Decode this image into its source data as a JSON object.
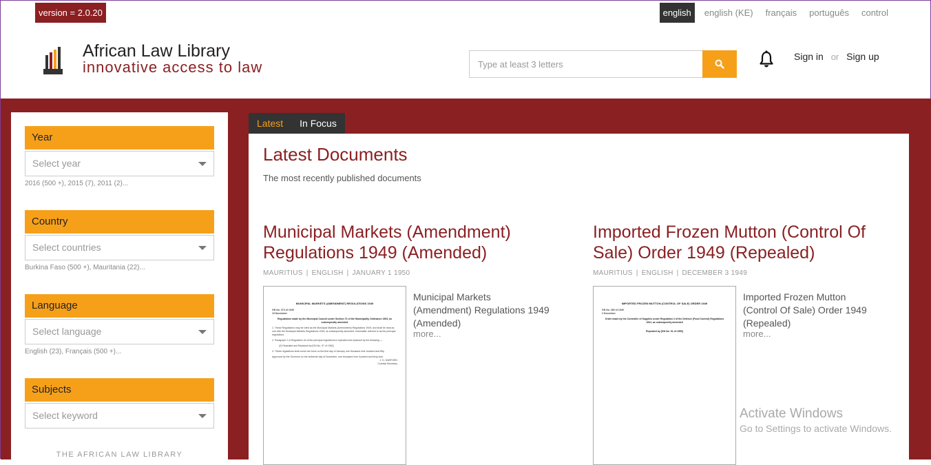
{
  "header": {
    "version": "version = 2.0.20",
    "languages": [
      "english",
      "english (KE)",
      "français",
      "português",
      "control"
    ],
    "brand_title": "African Law Library",
    "brand_tagline": "innovative access to law",
    "search_placeholder": "Type at least 3 letters",
    "sign_in": "Sign in",
    "or": "or",
    "sign_up": "Sign up"
  },
  "sidebar": {
    "filters": [
      {
        "label": "Year",
        "placeholder": "Select year",
        "hint": "2016 (500 +), 2015 (7), 2011 (2)..."
      },
      {
        "label": "Country",
        "placeholder": "Select countries",
        "hint": "Burkina Faso (500 +), Mauritania (22)..."
      },
      {
        "label": "Language",
        "placeholder": "Select language",
        "hint": "English (23), Français (500 +)..."
      },
      {
        "label": "Subjects",
        "placeholder": "Select keyword",
        "hint": ""
      }
    ],
    "footer": "THE AFRICAN LAW LIBRARY"
  },
  "tabs": [
    "Latest",
    "In Focus"
  ],
  "main": {
    "title": "Latest Documents",
    "subtitle": "The most recently published documents",
    "documents": [
      {
        "title": "Municipal Markets (Amendment) Regulations 1949 (Amended)",
        "country": "MAURITIUS",
        "language": "ENGLISH",
        "date": "JANUARY 1 1950",
        "summary": "Municipal Markets (Amendment) Regulations 1949 (Amended)",
        "more": "more...",
        "thumb": {
          "heading": "MUNICIPAL MARKETS (AMENDMENT) REGULATIONS 1949",
          "gn": "GN No. 273 of 1949",
          "gn_date": "19 November",
          "made_by": "Regulations made by the Municipal Council under Section 72 of the Municipality Ordinance 1903, as subsequently amended",
          "para1": "1.   These Regulations may be cited as the Municipal Markets (Amendment) Regulations 1949, and shall be read as one with the Municipal Markets Regulations 1945, as subsequently amended, hereinafter referred to as the principal regulations.",
          "para2": "2.   Paragraph 2 of Regulation 44 of the principal regulations is repealed and replaced by the following —",
          "para3": "(2)   Repealed and Replaced by [GN No. 97 of 1962]",
          "para4": "3.   These regulations shall come into force on the first day of January one thousand nine hundred and fifty.",
          "approved": "Approved by the Governor on the sixteenth day of November, one thousand nine hundred and forty-nine.",
          "signer": "J. D. HARFORD",
          "signer_title": "Colonial Secretary"
        }
      },
      {
        "title": "Imported Frozen Mutton (Control Of Sale) Order 1949 (Repealed)",
        "country": "MAURITIUS",
        "language": "ENGLISH",
        "date": "DECEMBER 3 1949",
        "summary": "Imported Frozen Mutton (Control Of Sale) Order 1949 (Repealed)",
        "more": "more...",
        "thumb": {
          "heading": "IMPORTED FROZEN MUTTON (CONTROL OF SALE) ORDER 1949",
          "gn": "GN No. 280 of 1949",
          "gn_date": "2 December",
          "made_by": "Order made by the Controller of Supplies under Regulation 3 of the Defence (Food Control) Regulations 1941, as subsequently amended",
          "repealed": "Repealed by [GN No. 91 of 1950]"
        }
      }
    ]
  },
  "watermark": {
    "line1": "Activate Windows",
    "line2": "Go to Settings to activate Windows."
  },
  "colors": {
    "brand": "#8a2022",
    "accent": "#f6a01a",
    "dark": "#333333"
  }
}
